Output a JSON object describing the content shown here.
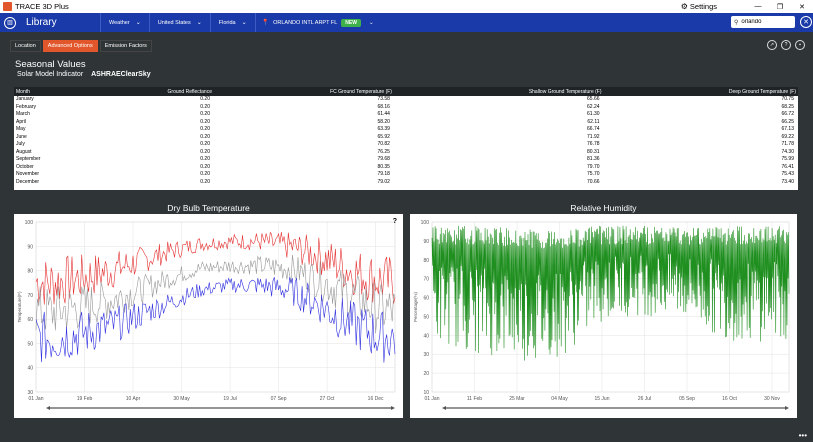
{
  "titlebar": {
    "app_title": "TRACE 3D Plus",
    "settings_label": "Settings",
    "minimize": "—",
    "restore": "❐",
    "close": "✕"
  },
  "nav": {
    "title": "Library",
    "crumbs": [
      "Weather",
      "United States",
      "Florida"
    ],
    "station": "ORLANDO INTL ARPT FL",
    "station_badge": "NEW",
    "search_value": "orlando"
  },
  "tabs": [
    {
      "label": "Location",
      "active": false
    },
    {
      "label": "Advanced Options",
      "active": true
    },
    {
      "label": "Emission Factors",
      "active": false
    }
  ],
  "section_title": "Seasonal Values",
  "solar": {
    "label": "Solar Model Indicator",
    "value": "ASHRAEClearSky"
  },
  "table": {
    "headers": [
      "Month",
      "Ground Reflectance",
      "FC Ground Temperature (F)",
      "Shallow Ground Temperature (F)",
      "Deep Ground Temperature (F)"
    ],
    "rows": [
      [
        "January",
        "0.20",
        "73.58",
        "65.66",
        "70.75"
      ],
      [
        "February",
        "0.20",
        "68.16",
        "62.24",
        "68.25"
      ],
      [
        "March",
        "0.20",
        "61.44",
        "61.30",
        "66.72"
      ],
      [
        "April",
        "0.20",
        "58.20",
        "62.11",
        "66.25"
      ],
      [
        "May",
        "0.20",
        "63.39",
        "66.74",
        "67.13"
      ],
      [
        "June",
        "0.20",
        "65.92",
        "71.92",
        "69.22"
      ],
      [
        "July",
        "0.20",
        "70.82",
        "76.78",
        "71.78"
      ],
      [
        "August",
        "0.20",
        "76.25",
        "80.31",
        "74.30"
      ],
      [
        "September",
        "0.20",
        "79.68",
        "81.36",
        "75.99"
      ],
      [
        "October",
        "0.20",
        "80.35",
        "79.70",
        "76.41"
      ],
      [
        "November",
        "0.20",
        "79.18",
        "75.70",
        "75.43"
      ],
      [
        "December",
        "0.20",
        "79.02",
        "70.66",
        "73.40"
      ]
    ]
  },
  "charts": {
    "dbt": {
      "title": "Dry Bulb Temperature",
      "ylabel": "Temperature(F)",
      "help": "?",
      "yticks": [
        "30",
        "40",
        "50",
        "60",
        "70",
        "80",
        "90",
        "100"
      ],
      "xticks": [
        "01 Jan",
        "19 Feb",
        "10 Apr",
        "30 May",
        "19 Jul",
        "07 Sep",
        "27 Oct",
        "16 Dec"
      ]
    },
    "rh": {
      "title": "Relative Humidity",
      "ylabel": "Percentage(%)",
      "yticks": [
        "10",
        "20",
        "30",
        "40",
        "50",
        "60",
        "70",
        "80",
        "90",
        "100"
      ],
      "xticks": [
        "01 Jan",
        "11 Feb",
        "25 Mar",
        "04 May",
        "15 Jun",
        "26 Jul",
        "05 Sep",
        "16 Oct",
        "30 Nov"
      ]
    }
  },
  "chart_data": [
    {
      "type": "line",
      "title": "Dry Bulb Temperature",
      "ylabel": "Temperature(F)",
      "ylim": [
        30,
        100
      ],
      "x_ticks": [
        "01 Jan",
        "19 Feb",
        "10 Apr",
        "30 May",
        "19 Jul",
        "07 Sep",
        "27 Oct",
        "16 Dec"
      ],
      "grid": true,
      "series_colors": [
        "#e53030",
        "#999999",
        "#3030e0"
      ],
      "x_months": [
        "Jan",
        "Feb",
        "Mar",
        "Apr",
        "May",
        "Jun",
        "Jul",
        "Aug",
        "Sep",
        "Oct",
        "Nov",
        "Dec"
      ],
      "series": [
        {
          "values": [
            75,
            77,
            80,
            84,
            88,
            91,
            92,
            92,
            90,
            86,
            80,
            76
          ]
        },
        {
          "values": [
            63,
            65,
            68,
            72,
            77,
            81,
            82,
            82,
            81,
            76,
            70,
            64
          ]
        },
        {
          "values": [
            52,
            54,
            57,
            62,
            67,
            72,
            74,
            74,
            72,
            66,
            58,
            53
          ]
        }
      ]
    },
    {
      "type": "line",
      "title": "Relative Humidity",
      "ylabel": "Percentage(%)",
      "ylim": [
        10,
        100
      ],
      "x_ticks": [
        "01 Jan",
        "11 Feb",
        "25 Mar",
        "04 May",
        "15 Jun",
        "26 Jul",
        "05 Sep",
        "16 Oct",
        "30 Nov"
      ],
      "grid": true,
      "series_colors": [
        "#1f8f1f"
      ],
      "x_months": [
        "Jan",
        "Feb",
        "Mar",
        "Apr",
        "May",
        "Jun",
        "Jul",
        "Aug",
        "Sep",
        "Oct",
        "Nov",
        "Dec"
      ],
      "series": [
        {
          "values_max": [
            98,
            98,
            97,
            96,
            96,
            98,
            98,
            98,
            98,
            98,
            98,
            98
          ],
          "values_min": [
            35,
            30,
            28,
            25,
            30,
            45,
            50,
            50,
            48,
            40,
            35,
            38
          ]
        }
      ]
    }
  ]
}
